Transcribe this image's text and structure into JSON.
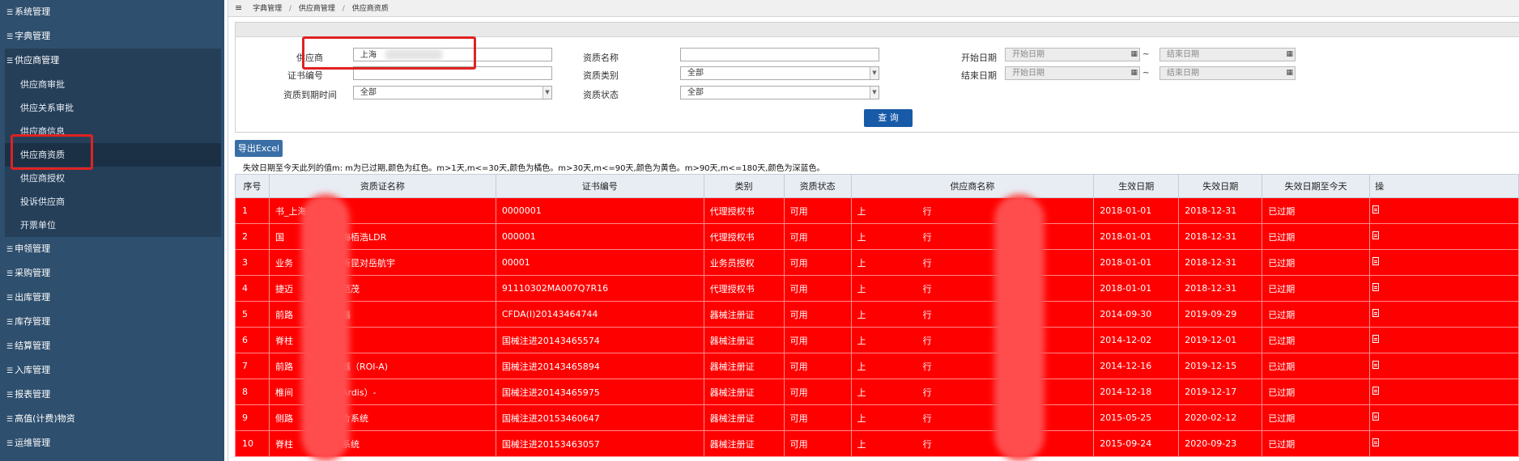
{
  "sidebar": {
    "top_items": [
      "系统管理",
      "字典管理"
    ],
    "open_group": {
      "label": "供应商管理",
      "children": [
        "供应商审批",
        "供应关系审批",
        "供应商信息",
        "供应商资质",
        "供应商授权",
        "投诉供应商",
        "开票单位"
      ],
      "active_index": 3
    },
    "bottom_items": [
      "申领管理",
      "采购管理",
      "出库管理",
      "库存管理",
      "结算管理",
      "入库管理",
      "报表管理",
      "高值(计费)物资",
      "运维管理"
    ]
  },
  "breadcrumb": {
    "items": [
      "字典管理",
      "供应商管理",
      "供应商资质"
    ]
  },
  "filters": {
    "supplier": {
      "label": "供应商",
      "value": "上海"
    },
    "qual_name": {
      "label": "资质名称",
      "value": ""
    },
    "start_date": {
      "label": "开始日期",
      "from_placeholder": "开始日期",
      "to_placeholder": "结束日期"
    },
    "cert_no": {
      "label": "证书编号",
      "value": ""
    },
    "qual_type": {
      "label": "资质类别",
      "value": "全部"
    },
    "end_date": {
      "label": "结束日期",
      "from_placeholder": "开始日期",
      "to_placeholder": "结束日期"
    },
    "expire_time": {
      "label": "资质到期时间",
      "value": "全部"
    },
    "qual_status": {
      "label": "资质状态",
      "value": "全部"
    },
    "tilde": "~",
    "query_button": "查 询"
  },
  "export_button": "导出Excel",
  "legend_note": "失效日期至今天此列的值m:  m为已过期,颜色为红色。m>1天,m<=30天,颜色为橘色。m>30天,m<=90天,颜色为黄色。m>90天,m<=180天,颜色为深蓝色。",
  "table": {
    "headers": [
      "序号",
      "资质证名称",
      "证书编号",
      "类别",
      "资质状态",
      "供应商名称",
      "生效日期",
      "失效日期",
      "失效日期至今天",
      "操"
    ],
    "rows": [
      {
        "seq": "1",
        "name": "书_上海济昆捷迈",
        "cert": "0000001",
        "type": "代理授权书",
        "status": "可用",
        "supplier": "上",
        "supplier_tail": "行",
        "start": "2018-01-01",
        "end": "2018-12-31",
        "remain": "已过期"
      },
      {
        "seq": "2",
        "name": "国",
        "name_tail": "上海栢浩LDR",
        "cert": "000001",
        "type": "代理授权书",
        "status": "可用",
        "supplier": "上",
        "supplier_tail": "行",
        "start": "2018-01-01",
        "end": "2018-12-31",
        "remain": "已过期"
      },
      {
        "seq": "3",
        "name": "业务",
        "name_tail": "所昆对岳航宇",
        "cert": "00001",
        "type": "业务员授权",
        "status": "可用",
        "supplier": "上",
        "supplier_tail": "行",
        "start": "2018-01-01",
        "end": "2018-12-31",
        "remain": "已过期"
      },
      {
        "seq": "4",
        "name": "捷迈",
        "name_tail": "范茂",
        "cert": "91110302MA007Q7R16",
        "type": "代理授权书",
        "status": "可用",
        "supplier": "上",
        "supplier_tail": "行",
        "start": "2018-01-01",
        "end": "2018-12-31",
        "remain": "已过期"
      },
      {
        "seq": "5",
        "name": "前路",
        "name_tail": "器",
        "cert": "CFDA(I)20143464744",
        "type": "器械注册证",
        "status": "可用",
        "supplier": "上",
        "supplier_tail": "行",
        "start": "2014-09-30",
        "end": "2019-09-29",
        "remain": "已过期"
      },
      {
        "seq": "6",
        "name": "脊柱",
        "name_tail": "",
        "cert": "国械注进20143465574",
        "type": "器械注册证",
        "status": "可用",
        "supplier": "上",
        "supplier_tail": "行",
        "start": "2014-12-02",
        "end": "2019-12-01",
        "remain": "已过期"
      },
      {
        "seq": "7",
        "name": "前路",
        "name_tail": "器（ROI-A)",
        "cert": "国械注进20143465894",
        "type": "器械注册证",
        "status": "可用",
        "supplier": "上",
        "supplier_tail": "行",
        "start": "2014-12-16",
        "end": "2019-12-15",
        "remain": "已过期"
      },
      {
        "seq": "8",
        "name": "椎间",
        "name_tail": "Ardis）-",
        "cert": "国械注进20143465975",
        "type": "器械注册证",
        "status": "可用",
        "supplier": "上",
        "supplier_tail": "行",
        "start": "2014-12-18",
        "end": "2019-12-17",
        "remain": "已过期"
      },
      {
        "seq": "9",
        "name": "侧路",
        "name_tail": "合系统",
        "cert": "国械注进20153460647",
        "type": "器械注册证",
        "status": "可用",
        "supplier": "上",
        "supplier_tail": "行",
        "start": "2015-05-25",
        "end": "2020-02-12",
        "remain": "已过期"
      },
      {
        "seq": "10",
        "name": "脊柱",
        "name_tail": "系统",
        "cert": "国械注进20153463057",
        "type": "器械注册证",
        "status": "可用",
        "supplier": "上",
        "supplier_tail": "行",
        "start": "2015-09-24",
        "end": "2020-09-23",
        "remain": "已过期"
      }
    ]
  },
  "colors": {
    "sidebar_bg": "#2e4f6e",
    "expired_row": "#ff0000",
    "query_button": "#175aa8",
    "annotation": "#e02222"
  }
}
